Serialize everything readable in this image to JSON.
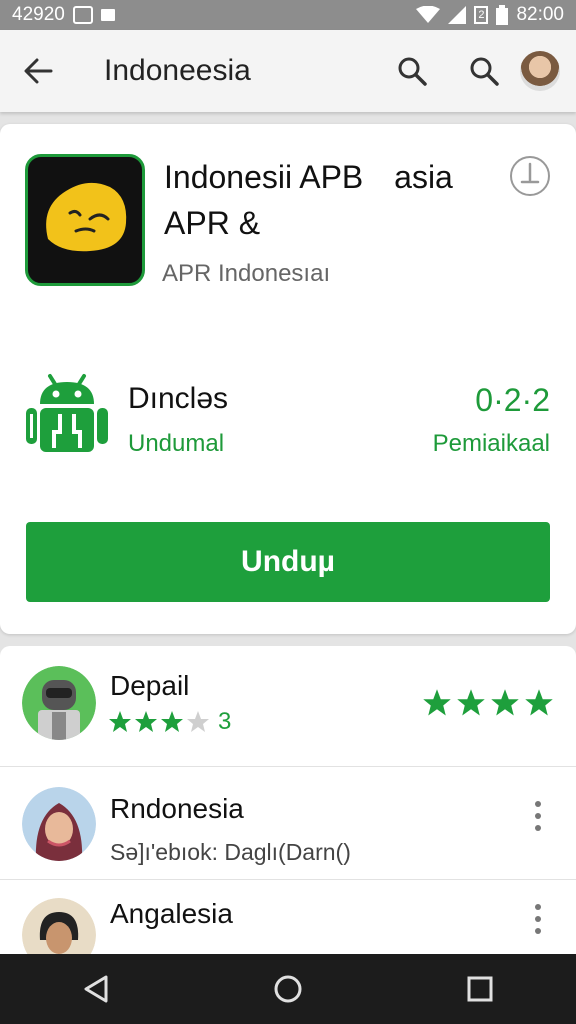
{
  "status_bar": {
    "time_left": "42920",
    "time_right": "82:00",
    "battery_label": "2"
  },
  "app_bar": {
    "title": "Indoneesia"
  },
  "app": {
    "name_line1": "Indonesii APB",
    "name_suffix": "asia",
    "name_line2": "APR &",
    "developer": "APR Indonesıaı"
  },
  "download": {
    "label": "Dıncləs",
    "sub": "Undumal",
    "version": "0·2·2",
    "version_sub": "Pemiaikaal"
  },
  "install": {
    "label": "Unduµ"
  },
  "detail": {
    "title": "Depail",
    "rating_count": "3",
    "left_stars_filled": 3,
    "left_stars_total": 4,
    "right_stars": 4
  },
  "reviews": [
    {
      "name": "Rndonesia",
      "text": "Sə]ı'ebıok: Daglı(Darn()"
    },
    {
      "name": "Angalesia",
      "text": ""
    }
  ],
  "colors": {
    "accent": "#1e9f3c",
    "status_bar": "#8d8d8d",
    "nav_bar": "#1c1c1c"
  }
}
